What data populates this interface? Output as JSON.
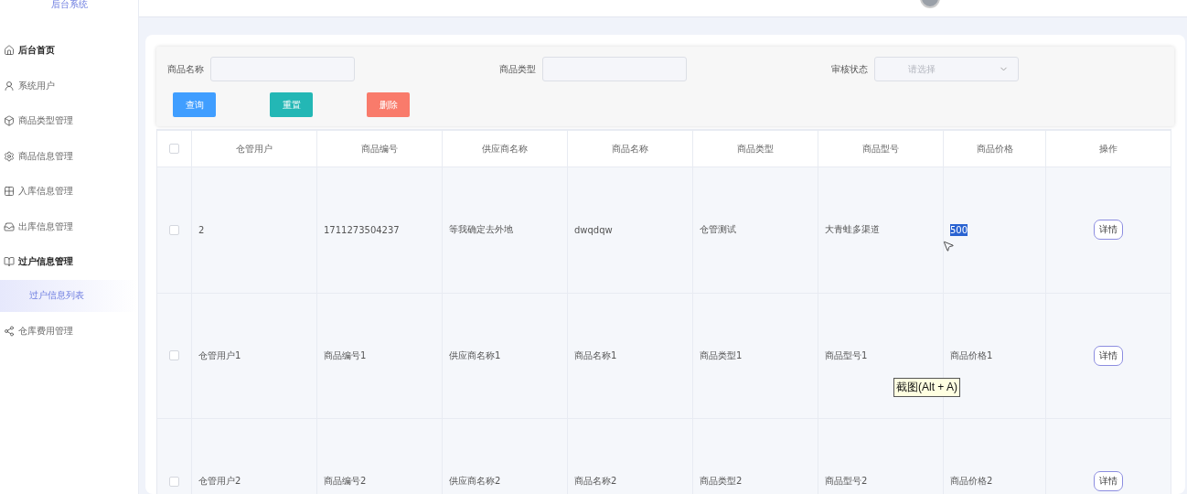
{
  "sidebar": {
    "title": "后台系统",
    "items": [
      {
        "label": "后台首页",
        "emphasized": true
      },
      {
        "label": "系统用户",
        "emphasized": false
      },
      {
        "label": "商品类型管理",
        "emphasized": false
      },
      {
        "label": "商品信息管理",
        "emphasized": false
      },
      {
        "label": "入库信息管理",
        "emphasized": false
      },
      {
        "label": "出库信息管理",
        "emphasized": false
      },
      {
        "label": "过户信息管理",
        "emphasized": true,
        "expanded": true,
        "children": [
          {
            "label": "过户信息列表",
            "selected": true
          }
        ]
      },
      {
        "label": "仓库费用管理",
        "emphasized": false
      }
    ]
  },
  "filters": [
    {
      "label": "商品名称",
      "kind": "input"
    },
    {
      "label": "商品类型",
      "kind": "input"
    },
    {
      "label": "审核状态",
      "kind": "select",
      "placeholder": "请选择"
    }
  ],
  "buttons": [
    {
      "label": "查询",
      "color": "#409eff"
    },
    {
      "label": "重置",
      "color": "#23b7b5"
    },
    {
      "label": "删除",
      "color": "#f97b6b"
    }
  ],
  "table": {
    "select_all_checked": false,
    "columns": [
      "仓管用户",
      "商品编号",
      "供应商名称",
      "商品名称",
      "商品类型",
      "商品型号",
      "商品价格",
      "操作"
    ],
    "rows": [
      {
        "checked": false,
        "price_highlighted": true,
        "cells": [
          "2",
          "1711273504237",
          "等我确定去外地",
          "dwqdqw",
          "仓管测试",
          "大青蛙多渠道",
          "500"
        ],
        "action": "详情"
      },
      {
        "checked": false,
        "price_highlighted": false,
        "cells": [
          "仓管用户1",
          "商品编号1",
          "供应商名称1",
          "商品名称1",
          "商品类型1",
          "商品型号1",
          "商品价格1"
        ],
        "action": "详情"
      },
      {
        "checked": false,
        "price_highlighted": false,
        "cells": [
          "仓管用户2",
          "商品编号2",
          "供应商名称2",
          "商品名称2",
          "商品类型2",
          "商品型号2",
          "商品价格2"
        ],
        "action": "详情"
      }
    ]
  },
  "tooltip": "截图(Alt + A)"
}
